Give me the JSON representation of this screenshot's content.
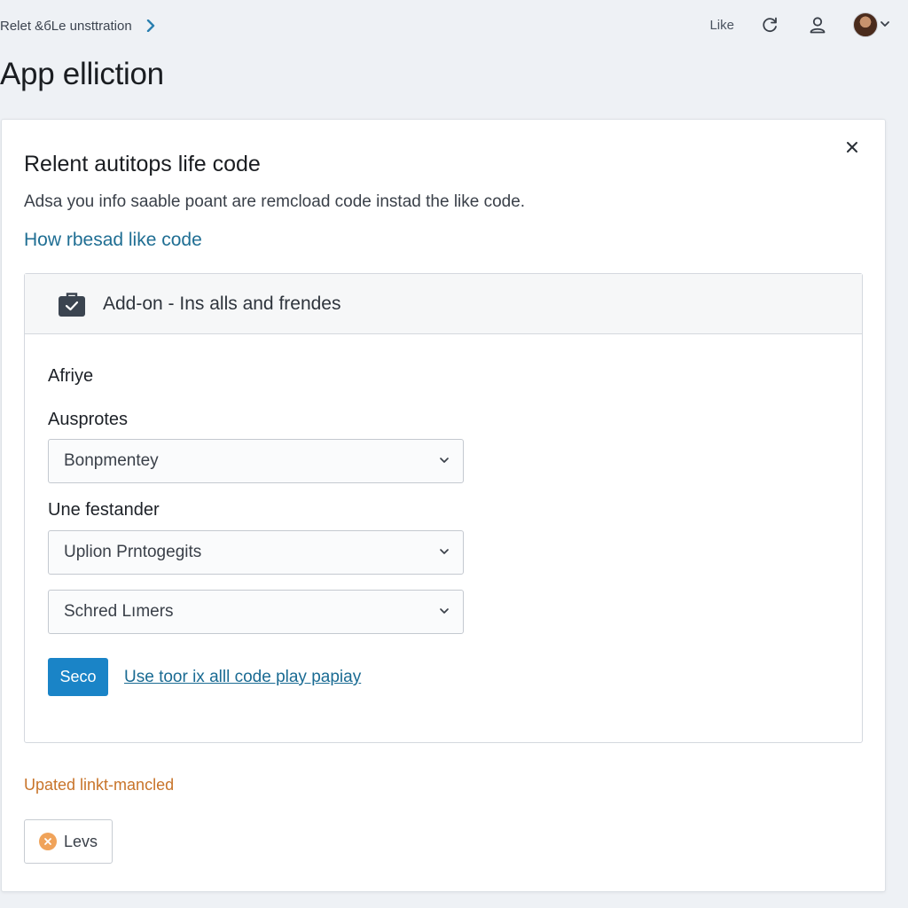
{
  "header": {
    "breadcrumb": "Relet &бLe unsttration",
    "right_link": "Like",
    "icons": [
      "chevron-right-icon",
      "refresh-icon",
      "user-icon",
      "avatar",
      "chevron-down-icon"
    ]
  },
  "page": {
    "title": "App elliction"
  },
  "dialog": {
    "title": "Relent autitops life code",
    "description": "Adsa you info saable poant are remcload code  instad the like code.",
    "help_link": "How rbesad like code",
    "panel": {
      "header_icon": "briefcase-check-icon",
      "header_text": "Add-on - Ins alls and frendes",
      "section_title": "Afriye",
      "field1_label": "Ausprotes",
      "field1_value": "Bonpmentey",
      "field2_label": "Une festander",
      "field2_value": "Uplion Prntogegits",
      "field3_value": "Schred Lımers",
      "primary_button": "Seco",
      "inline_link": "Use toor ix alll code play papiay"
    },
    "status_text": "Upated linkt-mancled",
    "secondary_button": "Levs"
  },
  "colors": {
    "primary": "#1a84c7",
    "link": "#1f6e93",
    "status": "#c8742a",
    "background": "#eef1f5"
  }
}
